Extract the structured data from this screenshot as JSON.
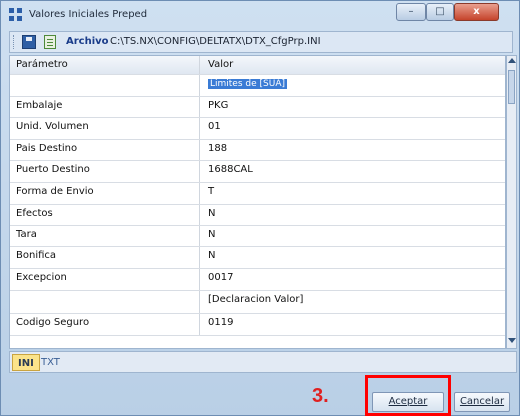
{
  "window": {
    "title": "Valores Iniciales Preped"
  },
  "title_controls": {
    "minimize": "–",
    "maximize": "□",
    "close": "x"
  },
  "toolbar": {
    "label": "Archivo",
    "path": "C:\\TS.NX\\CONFIG\\DELTATX\\DTX_CfgPrp.INI"
  },
  "grid": {
    "headers": [
      "Parámetro",
      "Valor"
    ],
    "rows": [
      {
        "param": "",
        "value": "Limites de [SUA]",
        "selected": true
      },
      {
        "param": "Embalaje",
        "value": "PKG"
      },
      {
        "param": "Unid. Volumen",
        "value": "01"
      },
      {
        "param": "Pais Destino",
        "value": "188"
      },
      {
        "param": "Puerto Destino",
        "value": "1688CAL"
      },
      {
        "param": "Forma de Envio",
        "value": "T"
      },
      {
        "param": "Efectos",
        "value": "N"
      },
      {
        "param": "Tara",
        "value": "N"
      },
      {
        "param": "Bonifica",
        "value": "N"
      },
      {
        "param": "Excepcion",
        "value": "0017"
      },
      {
        "param": "",
        "value": "[Declaracion Valor]"
      },
      {
        "param": "Codigo Seguro",
        "value": "0119"
      }
    ]
  },
  "tabs": [
    {
      "label": "INI"
    },
    {
      "label": "TXT"
    }
  ],
  "annotation": {
    "step": "3."
  },
  "buttons": {
    "accept": "Aceptar",
    "cancel": "Cancelar"
  },
  "colors": {
    "selection": "#3a7bd5",
    "highlight_box": "#ff0000",
    "step_text": "#e02020",
    "active_tab": "#fbe38a"
  }
}
